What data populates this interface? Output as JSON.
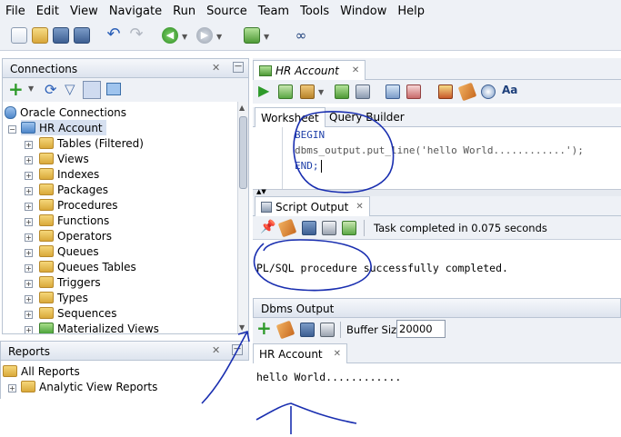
{
  "menu": [
    "File",
    "Edit",
    "View",
    "Navigate",
    "Run",
    "Source",
    "Team",
    "Tools",
    "Window",
    "Help"
  ],
  "connections": {
    "title": "Connections",
    "root": "Oracle Connections",
    "account": "HR Account",
    "items": [
      "Tables (Filtered)",
      "Views",
      "Indexes",
      "Packages",
      "Procedures",
      "Functions",
      "Operators",
      "Queues",
      "Queues Tables",
      "Triggers",
      "Types",
      "Sequences",
      "Materialized Views"
    ]
  },
  "reports": {
    "title": "Reports",
    "items": [
      "All Reports",
      "Analytic View Reports"
    ]
  },
  "editor": {
    "tab": "HR Account",
    "worksheet_tab": "Worksheet",
    "query_builder_tab": "Query Builder",
    "code": [
      "BEGIN",
      "dbms_output.put_line('hello World............');",
      "END;"
    ]
  },
  "script_output": {
    "title": "Script Output",
    "status": "Task completed in 0.075 seconds",
    "text": "PL/SQL procedure successfully completed."
  },
  "dbms_output": {
    "title": "Dbms Output",
    "buffer_label": "Buffer Size:",
    "buffer_value": "20000",
    "tab": "HR Account",
    "text": "hello World............"
  },
  "colors": {
    "annotation": "#1a2fb0",
    "panel_bg": "#eef1f6"
  }
}
